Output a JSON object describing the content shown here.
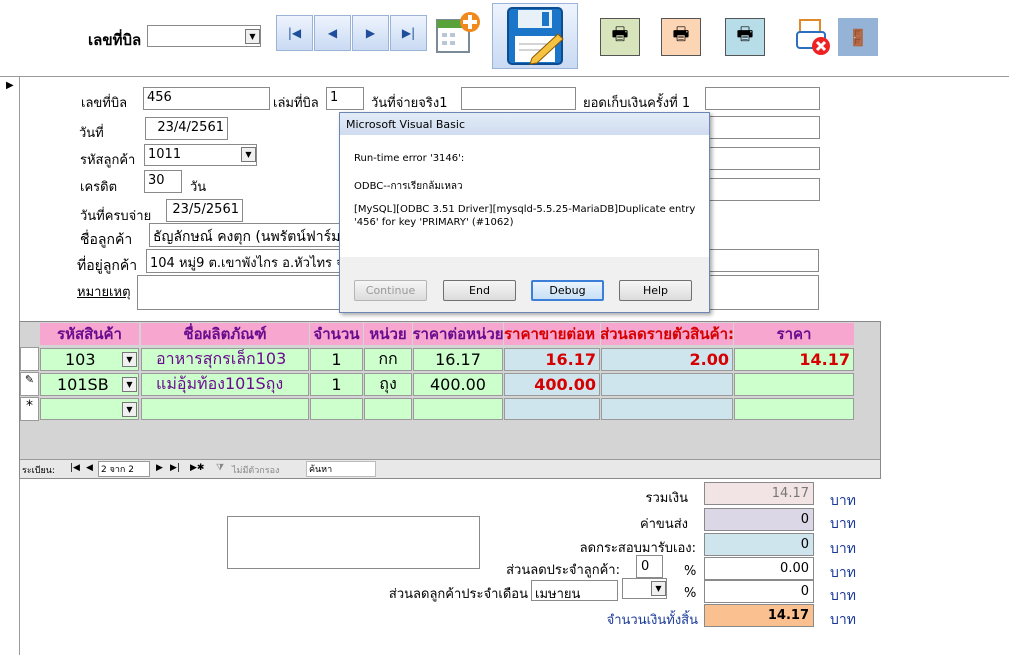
{
  "top": {
    "bill_no_label": "เลขที่บิล",
    "bill_no_select": ""
  },
  "nav": {
    "first": "first-record",
    "prev": "previous-record",
    "next": "next-record",
    "last": "last-record"
  },
  "form": {
    "bill_no_label": "เลขที่บิล",
    "bill_no": "456",
    "book_label": "เล่มที่บิล",
    "book": "1",
    "actual_pay_label": "วันที่จ่ายจริง1",
    "actual_pay": "",
    "collect_label": "ยอดเก็บเงินครั้งที่ 1",
    "collect": "",
    "date_label": "วันที่",
    "date": "23/4/2561",
    "customer_code_label": "รหัสลูกค้า",
    "customer_code": "1011",
    "credit_label": "เครดิต",
    "credit": "30",
    "credit_unit": "วัน",
    "due_label": "วันที่ครบจ่าย",
    "due": "23/5/2561",
    "customer_name_label": "ชื่อลูกค้า",
    "customer_name": "ธัญลักษณ์  คงตุก (นพรัตน์ฟาร์ม",
    "address_label": "ที่อยู่ลูกค้า",
    "address": "104 หมู่9 ต.เขาพังไกร อ.หัวไทร จ",
    "note_label": "หมายเหตุ",
    "note": ""
  },
  "grid": {
    "headers": [
      "รหัสสินค้า",
      "ชื่อผลิตภัณฑ์",
      "จำนวน",
      "หน่วย",
      "ราคาต่อหน่วย",
      "ราคาขายต่อห",
      "ส่วนลดรายตัวสินค้า:",
      "ราคา"
    ],
    "rows": [
      {
        "code": "103",
        "name": "อาหารสุกรเล็ก103",
        "qty": "1",
        "unit": "กก",
        "unit_price": "16.17",
        "sale_price": "16.17",
        "discount": "2.00",
        "price": "14.17"
      },
      {
        "code": "101SB",
        "name": "แม่อุ้มท้อง101Sถุง",
        "qty": "1",
        "unit": "ถุง",
        "unit_price": "400.00",
        "sale_price": "400.00",
        "discount": "",
        "price": ""
      }
    ],
    "new_row_marker": "*"
  },
  "recnav": {
    "label": "ระเบียน:",
    "position": "2 จาก 2",
    "filter": "ไม่มีตัวกรอง",
    "search": "ค้นหา"
  },
  "summary": {
    "total_label": "รวมเงิน",
    "total": "14.17",
    "shipping_label": "ค่าขนส่ง",
    "shipping": "0",
    "bag_label": "ลดกระสอบมารับเอง:",
    "bag": "0",
    "cust_disc_label": "ส่วนลดประจำลูกค้า:",
    "cust_disc_pct": "0",
    "cust_disc": "0.00",
    "monthly_label": "ส่วนลดลูกค้าประจำเดือน",
    "monthly_month": "เมษายน",
    "monthly": "0",
    "grand_label": "จำนวนเงินทั้งสิ้น",
    "grand": "14.17",
    "pct": "%",
    "baht": "บาท"
  },
  "dialog": {
    "title": "Microsoft Visual Basic",
    "line1": "Run-time error '3146':",
    "line2": "ODBC--การเรียกล้มเหลว",
    "line3": "[MySQL][ODBC 3.51 Driver][mysqld-5.5.25-MariaDB]Duplicate entry",
    "line4": "'456' for key 'PRIMARY' (#1062)",
    "btn_continue": "Continue",
    "btn_end": "End",
    "btn_debug": "Debug",
    "btn_help": "Help"
  },
  "colors": {
    "header_pink": "#f7a6cf",
    "cell_green": "#ccffcc",
    "cell_blue": "#cfe5ee",
    "grand_orange": "#fac090",
    "red_value": "#d60000"
  }
}
